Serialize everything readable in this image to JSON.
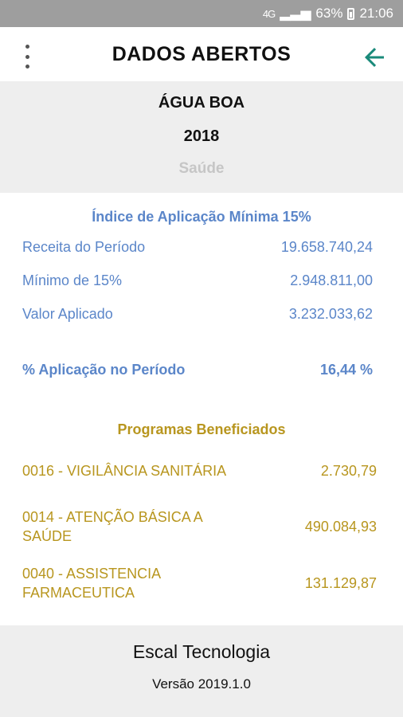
{
  "status_bar": {
    "network": "4G",
    "battery": "63%",
    "time": "21:06"
  },
  "app_bar": {
    "title": "DADOS ABERTOS",
    "menu_icon": "more-vert-icon",
    "back_icon": "arrow-back-icon"
  },
  "header": {
    "municipio": "ÁGUA BOA",
    "ano": "2018",
    "area": "Saúde"
  },
  "indice": {
    "title": "Índice de Aplicação Mínima 15%",
    "rows": [
      {
        "label": "Receita do Período",
        "value": "19.658.740,24"
      },
      {
        "label": "Mínimo de 15%",
        "value": "2.948.811,00"
      },
      {
        "label": "Valor Aplicado",
        "value": "3.232.033,62"
      }
    ],
    "aplicacao": {
      "label": "% Aplicação no Período",
      "value": "16,44 %"
    }
  },
  "programas": {
    "title": "Programas Beneficiados",
    "items": [
      {
        "name": "0016 - VIGILÂNCIA SANITÁRIA",
        "value": "2.730,79"
      },
      {
        "name": "0014 - ATENÇÃO BÁSICA A SAÚDE",
        "value": "490.084,93"
      },
      {
        "name": "0040 - ASSISTENCIA FARMACEUTICA",
        "value": "131.129,87"
      }
    ]
  },
  "footer": {
    "company": "Escal Tecnologia",
    "version": "Versão 2019.1.0"
  },
  "colors": {
    "accent_blue": "#5b86c9",
    "accent_gold": "#b8961f",
    "back_arrow": "#1a8a7a"
  }
}
